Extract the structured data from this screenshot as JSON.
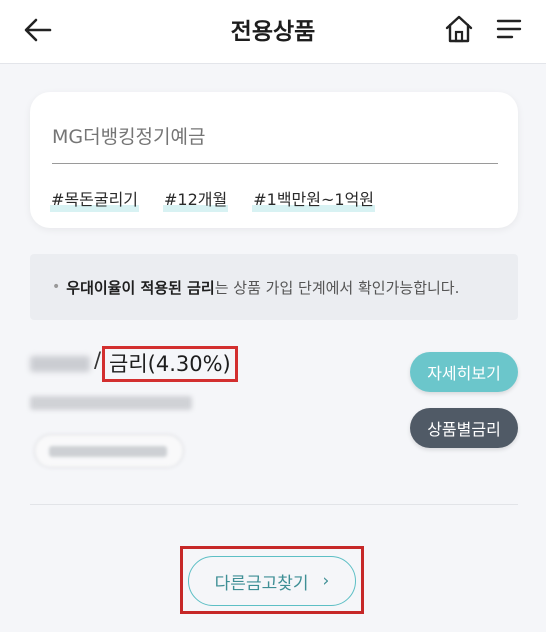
{
  "header": {
    "title": "전용상품",
    "icons": {
      "back": "arrow-left-icon",
      "home": "home-icon",
      "menu": "hamburger-menu-icon"
    }
  },
  "search": {
    "placeholder": "MG더뱅킹정기예금",
    "tags": [
      "#목돈굴리기",
      "#12개월",
      "#1백만원~1억원"
    ]
  },
  "notice": {
    "bullet": "•",
    "bold": "우대이율이 적용된 금리",
    "rest": "는 상품 가입 단계에서 확인가능합니다."
  },
  "result": {
    "separator": "/",
    "rate_label": "금리(4.30%)",
    "detail_button": "자세히보기",
    "rate_button": "상품별금리"
  },
  "footer": {
    "find_button": "다른금고찾기",
    "find_chevron": "›"
  },
  "colors": {
    "accent": "#6bc6cb",
    "dark_button": "#505a66",
    "highlight_box": "#d32f2f",
    "background": "#f5f6f9"
  }
}
